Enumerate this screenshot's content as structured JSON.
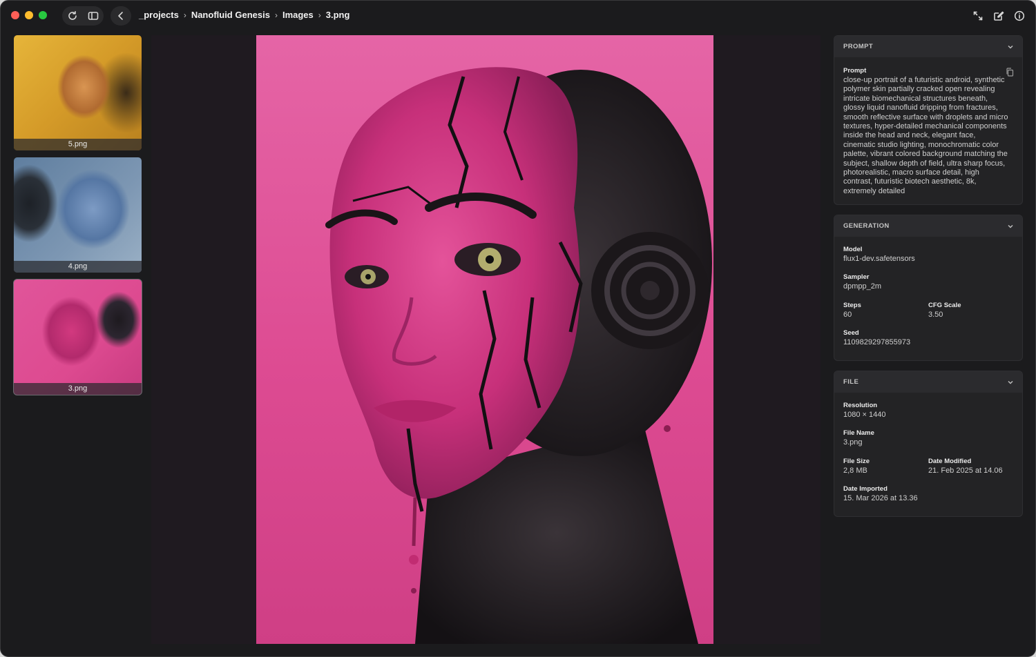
{
  "breadcrumb": [
    "_projects",
    "Nanofluid Genesis",
    "Images",
    "3.png"
  ],
  "thumbnails": [
    {
      "name": "5.png",
      "selected": false
    },
    {
      "name": "4.png",
      "selected": false
    },
    {
      "name": "3.png",
      "selected": true
    }
  ],
  "inspector": {
    "prompt": {
      "header": "PROMPT",
      "label": "Prompt",
      "text": "close-up portrait of a futuristic android, synthetic polymer skin partially cracked open revealing intricate biomechanical structures beneath, glossy liquid nanofluid dripping from fractures, smooth reflective surface with droplets and micro textures, hyper-detailed mechanical components inside the head and neck, elegant face, cinematic studio lighting, monochromatic color palette, vibrant colored background matching the subject, shallow depth of field, ultra sharp focus, photorealistic, macro surface detail, high contrast, futuristic biotech aesthetic, 8k, extremely detailed"
    },
    "generation": {
      "header": "GENERATION",
      "model_label": "Model",
      "model": "flux1-dev.safetensors",
      "sampler_label": "Sampler",
      "sampler": "dpmpp_2m",
      "steps_label": "Steps",
      "steps": "60",
      "cfg_label": "CFG Scale",
      "cfg": "3.50",
      "seed_label": "Seed",
      "seed": "1109829297855973"
    },
    "file": {
      "header": "FILE",
      "resolution_label": "Resolution",
      "resolution": "1080 × 1440",
      "filename_label": "File Name",
      "filename": "3.png",
      "filesize_label": "File Size",
      "filesize": "2,8 MB",
      "modified_label": "Date Modified",
      "modified": "21. Feb 2025 at 14.06",
      "imported_label": "Date Imported",
      "imported": "15. Mar 2026 at 13.36"
    }
  },
  "colors": {
    "window_bg": "#1b1b1d",
    "panel_bg": "#232325",
    "image_bg_pink": "#dd4b92"
  }
}
